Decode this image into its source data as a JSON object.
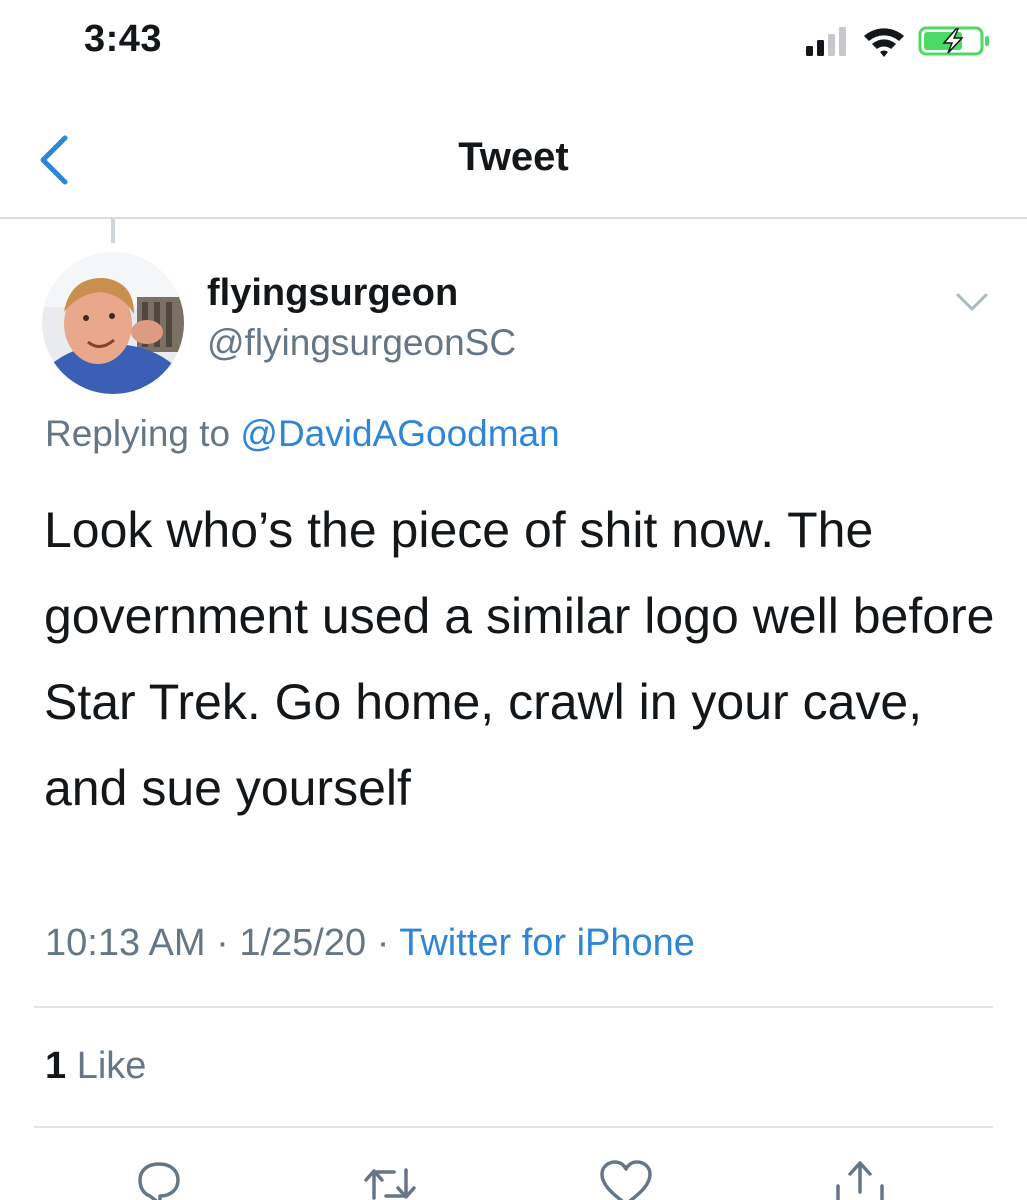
{
  "status_bar": {
    "time": "3:43"
  },
  "nav": {
    "title": "Tweet",
    "back_icon": "chevron-left-icon"
  },
  "tweet": {
    "display_name": "flyingsurgeon",
    "handle": "@flyingsurgeonSC",
    "replying_prefix": "Replying to",
    "replying_to": "@DavidAGoodman",
    "text": "Look who’s the piece of shit now. The government used a similar logo well before Star Trek. Go home, crawl in your cave, and sue yourself",
    "time": "10:13 AM",
    "date": "1/25/20",
    "separator": "·",
    "source": "Twitter for iPhone",
    "like_count": "1",
    "like_label": "Like"
  },
  "actions": [
    {
      "icon": "reply-icon"
    },
    {
      "icon": "retweet-icon"
    },
    {
      "icon": "heart-icon"
    },
    {
      "icon": "share-icon"
    }
  ],
  "colors": {
    "link": "#2f86d6",
    "secondary_text": "#657786",
    "primary_text": "#14171a",
    "battery_green": "#4cd964"
  }
}
